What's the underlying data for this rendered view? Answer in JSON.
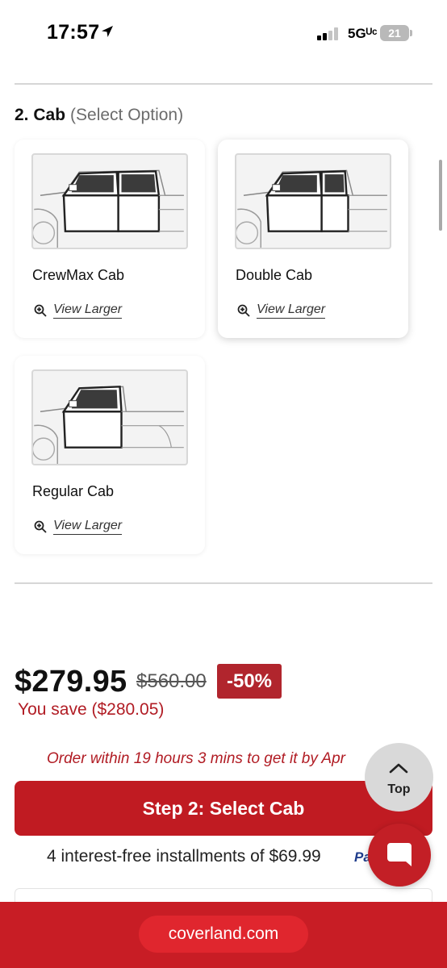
{
  "status_bar": {
    "time": "17:57",
    "network": "5Gᵁᶜ",
    "battery": "21",
    "icons": [
      "location-arrow-icon",
      "signal-bars-icon",
      "battery-icon"
    ]
  },
  "section": {
    "number_title": "2. Cab",
    "hint": "(Select Option)"
  },
  "cab_options": [
    {
      "name": "CrewMax Cab",
      "view_label": "View Larger",
      "selected": false
    },
    {
      "name": "Double Cab",
      "view_label": "View Larger",
      "selected": true
    },
    {
      "name": "Regular Cab",
      "view_label": "View Larger",
      "selected": false
    }
  ],
  "pricing": {
    "price": "$279.95",
    "original_price": "$560.00",
    "discount": "-50%",
    "savings": "You save ($280.05)"
  },
  "order_note": "Order within 19 hours 3 mins to get it by Apr",
  "cta": {
    "label": "Step 2: Select Cab"
  },
  "installments": {
    "text": "4 interest-free installments of $69.99",
    "provider": "Pa"
  },
  "floating": {
    "top_label": "Top",
    "icons": [
      "chevron-up-icon",
      "chat-bubble-icon"
    ]
  },
  "browser": {
    "url": "coverland.com"
  },
  "colors": {
    "brand_red": "#c01b22",
    "discount_bg": "#b1252d",
    "savings_text": "#b11c24",
    "paypal_blue": "#1f3d8c"
  }
}
